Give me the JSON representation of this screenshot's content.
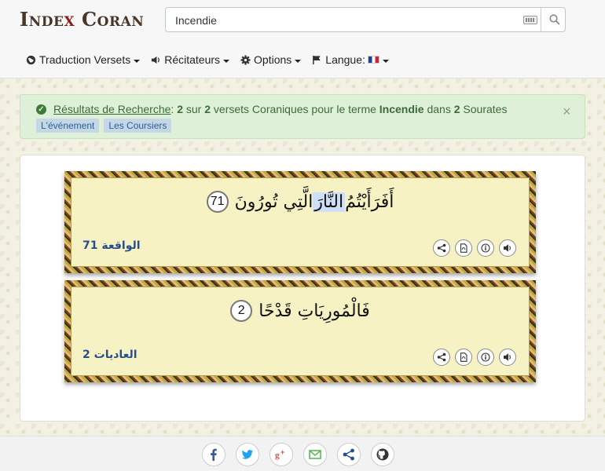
{
  "header": {
    "logo": {
      "part1": "Inde",
      "x": "x",
      "part2": " Coran"
    },
    "search": {
      "value": "Incendie",
      "placeholder": ""
    },
    "nav": [
      {
        "label": "Traduction Versets",
        "icon": "globe-icon"
      },
      {
        "label": "Récitateurs",
        "icon": "volume-icon"
      },
      {
        "label": "Options",
        "icon": "gear-icon"
      },
      {
        "label": "Langue:",
        "icon": "flag-icon"
      }
    ]
  },
  "alert": {
    "link": "Résultats de Recherche",
    "colon": ":",
    "count": "2",
    "sur": " sur ",
    "total": "2",
    "mid": " versets Coraniques pour le terme ",
    "term": "Incendie",
    "dans": " dans ",
    "suras": "2",
    "tail": " Sourates",
    "close": "×",
    "tags": [
      "L'événement",
      "Les Coursiers"
    ]
  },
  "verses": [
    {
      "before": "أَفَرَأَيْتُمُ ",
      "highlight": "النَّارَ",
      "after": " الَّتِي تُورُونَ",
      "number": "71",
      "sura_ref": "الواقعة 71"
    },
    {
      "before": "فَالْمُورِيَاتِ قَدْحًا",
      "highlight": "",
      "after": "",
      "number": "2",
      "sura_ref": "العاديات 2"
    }
  ],
  "colors": {
    "accent": "#2a4e8c",
    "alert_bg": "#dff0d8",
    "verse_bg": "#f6f2c4",
    "facebook": "#3b5998",
    "twitter": "#1da1f2",
    "google": "#dd4b39",
    "email": "#5cb85c",
    "share": "#2a4e8c",
    "github": "#333333"
  },
  "footer": {
    "social": [
      "facebook-icon",
      "twitter-icon",
      "google-plus-icon",
      "email-icon",
      "share-icon",
      "github-icon"
    ]
  }
}
